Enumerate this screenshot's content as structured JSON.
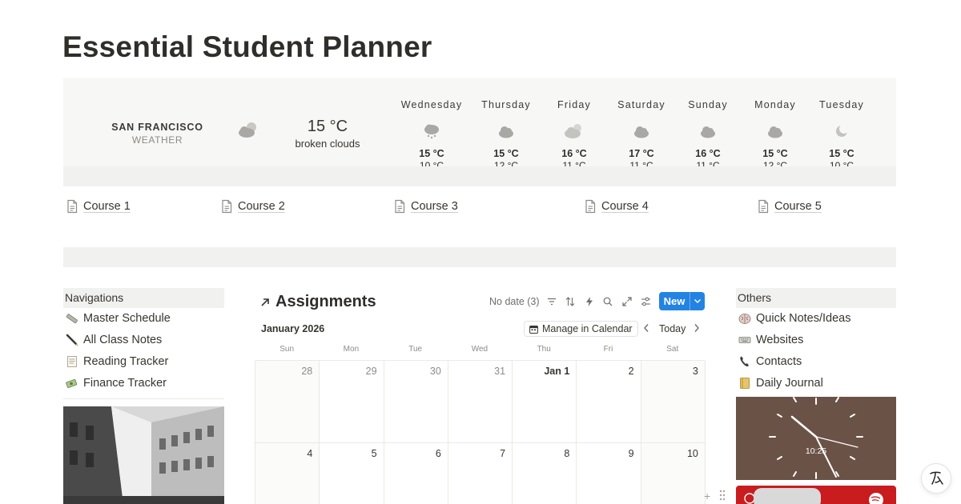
{
  "page": {
    "title": "Essential Student Planner"
  },
  "weather": {
    "city": "SAN FRANCISCO",
    "subtitle": "WEATHER",
    "current_temp": "15 °C",
    "current_desc": "broken clouds",
    "current_icon": "broken-clouds-icon",
    "forecast": [
      {
        "day": "Wednesday",
        "high": "15 °C",
        "low": "10 °C",
        "icon": "rain-cloud-icon"
      },
      {
        "day": "Thursday",
        "high": "15 °C",
        "low": "12 °C",
        "icon": "cloud-icon"
      },
      {
        "day": "Friday",
        "high": "16 °C",
        "low": "11 °C",
        "icon": "partly-cloudy-icon"
      },
      {
        "day": "Saturday",
        "high": "17 °C",
        "low": "11 °C",
        "icon": "cloud-icon"
      },
      {
        "day": "Sunday",
        "high": "16 °C",
        "low": "11 °C",
        "icon": "cloud-icon"
      },
      {
        "day": "Monday",
        "high": "15 °C",
        "low": "12 °C",
        "icon": "cloud-icon"
      },
      {
        "day": "Tuesday",
        "high": "15 °C",
        "low": "10 °C",
        "icon": "moon-icon"
      }
    ]
  },
  "courses": [
    "Course 1",
    "Course 2",
    "Course 3",
    "Course 4",
    "Course 5"
  ],
  "navigations": {
    "heading": "Navigations",
    "items": [
      {
        "label": "Master Schedule",
        "icon": "ruler-icon"
      },
      {
        "label": "All Class Notes",
        "icon": "pen-icon"
      },
      {
        "label": "Reading Tracker",
        "icon": "page-icon"
      },
      {
        "label": "Finance Tracker",
        "icon": "money-icon"
      }
    ]
  },
  "others": {
    "heading": "Others",
    "items": [
      {
        "label": "Quick Notes/Ideas",
        "icon": "brain-icon"
      },
      {
        "label": "Websites",
        "icon": "keyboard-icon"
      },
      {
        "label": "Contacts",
        "icon": "telephone-icon"
      },
      {
        "label": "Daily Journal",
        "icon": "notebook-icon"
      }
    ],
    "clock_time": "10:25"
  },
  "assignments": {
    "title": "Assignments",
    "no_date": "No date (3)",
    "new_label": "New",
    "month": "January 2026",
    "manage_label": "Manage in Calendar",
    "today_label": "Today",
    "weekdays": [
      "Sun",
      "Mon",
      "Tue",
      "Wed",
      "Thu",
      "Fri",
      "Sat"
    ],
    "weeks": [
      [
        "28",
        "29",
        "30",
        "31",
        "Jan 1",
        "2",
        "3"
      ],
      [
        "4",
        "5",
        "6",
        "7",
        "8",
        "9",
        "10"
      ]
    ]
  },
  "colors": {
    "accent": "#2383e2",
    "clock_bg": "#6b5247",
    "spotify_red": "#c81c1f"
  }
}
